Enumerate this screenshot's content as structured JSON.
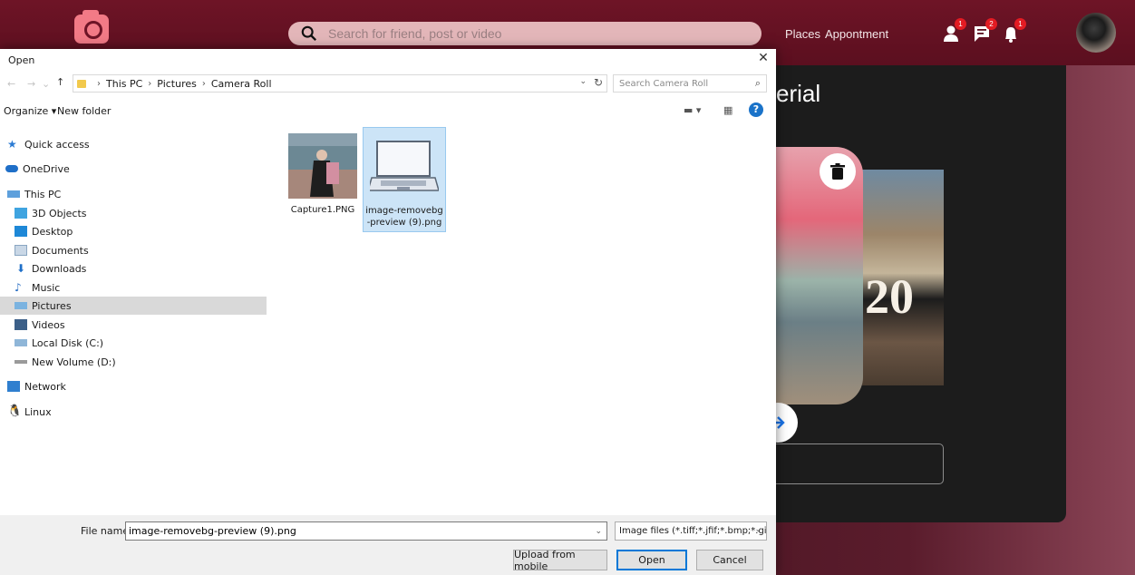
{
  "app": {
    "search_placeholder": "Search for friend, post or video",
    "nav_links": [
      "Places",
      "Appontment"
    ],
    "badges": [
      "1",
      "2",
      "1"
    ],
    "panel_title": "erial",
    "card_year": "20",
    "brand_color": "#6e1426"
  },
  "dialog": {
    "title": "Open",
    "close_symbol": "✕",
    "breadcrumb": [
      "This PC",
      "Pictures",
      "Camera Roll"
    ],
    "search_placeholder": "Search Camera Roll",
    "toolbar": {
      "organize": "Organize ▾",
      "new_folder": "New folder"
    },
    "nav_items": [
      {
        "label": "Quick access",
        "icon": "star-icon"
      },
      {
        "label": "OneDrive",
        "icon": "cloud-icon"
      },
      {
        "label": "This PC",
        "icon": "computer-icon"
      },
      {
        "label": "3D Objects",
        "icon": "cube-icon"
      },
      {
        "label": "Desktop",
        "icon": "desktop-icon"
      },
      {
        "label": "Documents",
        "icon": "document-icon"
      },
      {
        "label": "Downloads",
        "icon": "download-icon"
      },
      {
        "label": "Music",
        "icon": "music-icon"
      },
      {
        "label": "Pictures",
        "icon": "pictures-icon"
      },
      {
        "label": "Videos",
        "icon": "video-icon"
      },
      {
        "label": "Local Disk (C:)",
        "icon": "disk-icon"
      },
      {
        "label": "New Volume (D:)",
        "icon": "drive-icon"
      },
      {
        "label": "Network",
        "icon": "network-icon"
      },
      {
        "label": "Linux",
        "icon": "linux-icon"
      }
    ],
    "selected_nav": "Pictures",
    "files": [
      {
        "name": "Capture1.PNG",
        "selected": false
      },
      {
        "name": "image-removebg\n-preview (9).png",
        "selected": true
      }
    ],
    "file_name_label": "File name:",
    "file_name_value": "image-removebg-preview (9).png",
    "filter_value": "Image files (*.tiff;*.jfif;*.bmp;*.gi",
    "buttons": {
      "upload": "Upload from mobile",
      "open": "Open",
      "cancel": "Cancel"
    }
  }
}
